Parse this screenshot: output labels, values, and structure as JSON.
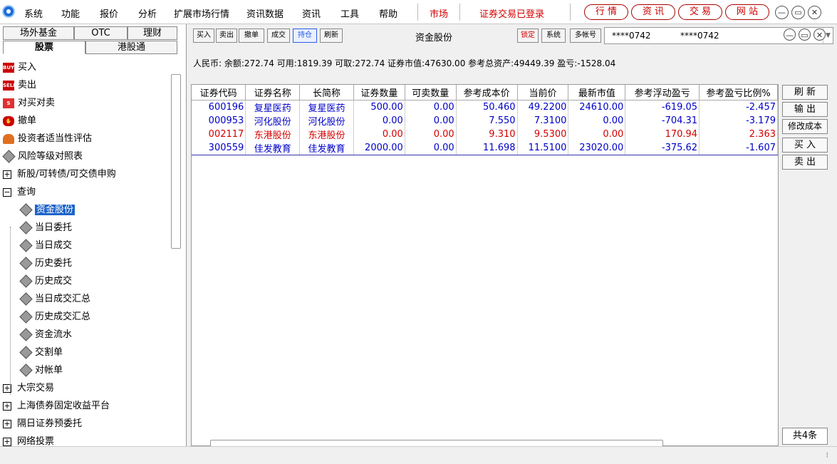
{
  "menubar": {
    "items": [
      "系统",
      "功能",
      "报价",
      "分析",
      "扩展市场行情",
      "资讯数据",
      "资讯",
      "工具",
      "帮助"
    ],
    "market": "市场",
    "login_status": "证券交易已登录",
    "pills": [
      "行 情",
      "资 讯",
      "交 易",
      "网 站"
    ]
  },
  "left_tabs": {
    "row1": [
      "场外基金",
      "OTC",
      "理财"
    ],
    "row2": [
      "股票",
      "港股通"
    ]
  },
  "tree": {
    "buy": "买入",
    "sell": "卖出",
    "buysell": "对买对卖",
    "cancel": "撤单",
    "assess": "投资者适当性评估",
    "risk": "风险等级对照表",
    "ipo": "新股/可转债/可交债申购",
    "query": "查询",
    "sub": [
      "资金股份",
      "当日委托",
      "当日成交",
      "历史委托",
      "历史成交",
      "当日成交汇总",
      "历史成交汇总",
      "资金流水",
      "交割单",
      "对帐单"
    ],
    "block": "大宗交易",
    "bond": "上海债券固定收益平台",
    "pre": "隔日证券预委托",
    "vote": "网络投票"
  },
  "toolbar": {
    "buttons": [
      "买入",
      "卖出",
      "撤单",
      "成交",
      "持仓",
      "刷新"
    ],
    "title": "资金股份",
    "lock": "锁定",
    "system": "系统",
    "multi": "多帐号",
    "acct1": "****0742",
    "acct2": "****0742"
  },
  "summary": "人民币: 余额:272.74  可用:1819.39  可取:272.74  证券市值:47630.00  参考总资产:49449.39  盈亏:-1528.04",
  "table": {
    "headers": [
      "证券代码",
      "证券名称",
      "长简称",
      "证券数量",
      "可卖数量",
      "参考成本价",
      "当前价",
      "最新市值",
      "参考浮动盈亏",
      "参考盈亏比例%"
    ],
    "rows": [
      [
        "600196",
        "复星医药",
        "复星医药",
        "500.00",
        "0.00",
        "50.460",
        "49.2200",
        "24610.00",
        "-619.05",
        "-2.457"
      ],
      [
        "000953",
        "河化股份",
        "河化股份",
        "0.00",
        "0.00",
        "7.550",
        "7.3100",
        "0.00",
        "-704.31",
        "-3.179"
      ],
      [
        "002117",
        "东港股份",
        "东港股份",
        "0.00",
        "0.00",
        "9.310",
        "9.5300",
        "0.00",
        "170.94",
        "2.363"
      ],
      [
        "300559",
        "佳发教育",
        "佳发教育",
        "2000.00",
        "0.00",
        "11.698",
        "11.5100",
        "23020.00",
        "-375.62",
        "-1.607"
      ]
    ]
  },
  "right_buttons": [
    "刷 新",
    "输 出",
    "修改成本",
    "买 入",
    "卖 出"
  ],
  "count": "共4条",
  "colors": {
    "blue": "#0000c8",
    "red": "#d40000",
    "select": "#1e64c8"
  }
}
